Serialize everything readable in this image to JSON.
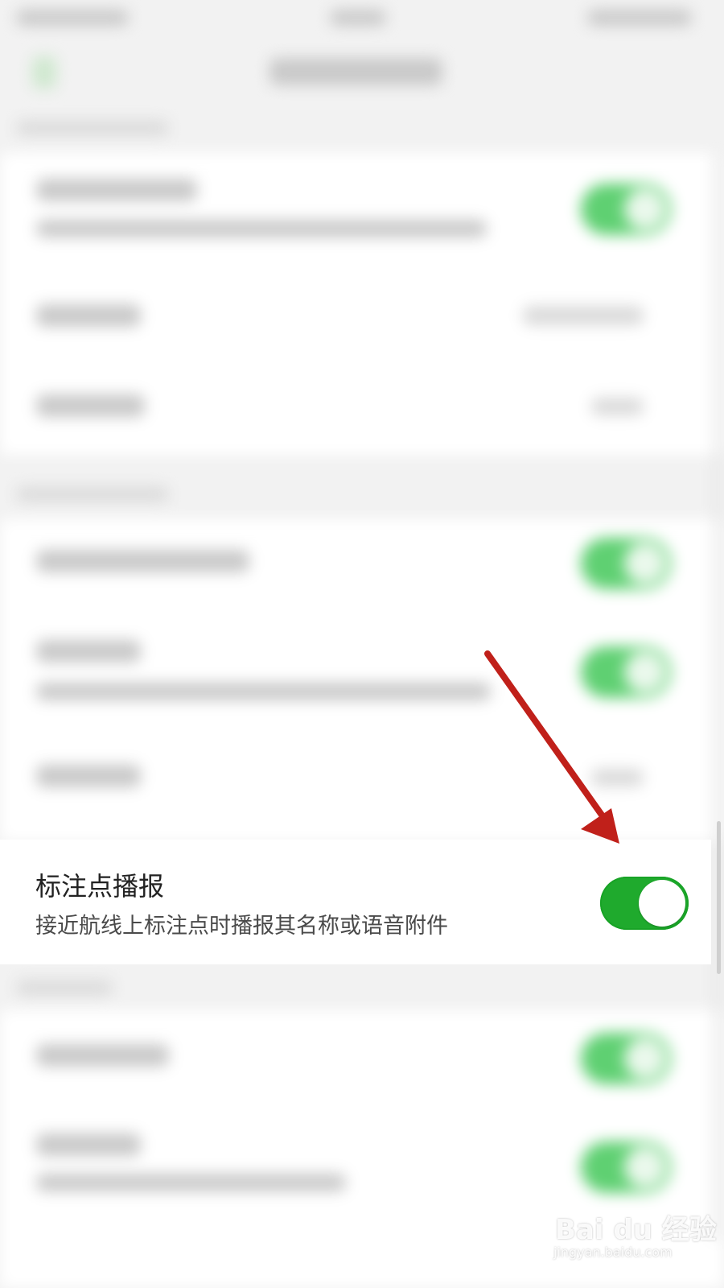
{
  "setting": {
    "title": "标注点播报",
    "description": "接近航线上标注点时播报其名称或语音附件",
    "enabled": true
  },
  "watermark": {
    "logo": "Bai du 经验",
    "url": "jingyan.baidu.com"
  },
  "colors": {
    "toggle_on": "#1faa2d",
    "arrow": "#c0201a"
  },
  "icons": {
    "back": "back-chevron-icon",
    "annotation": "red-arrow-icon"
  }
}
